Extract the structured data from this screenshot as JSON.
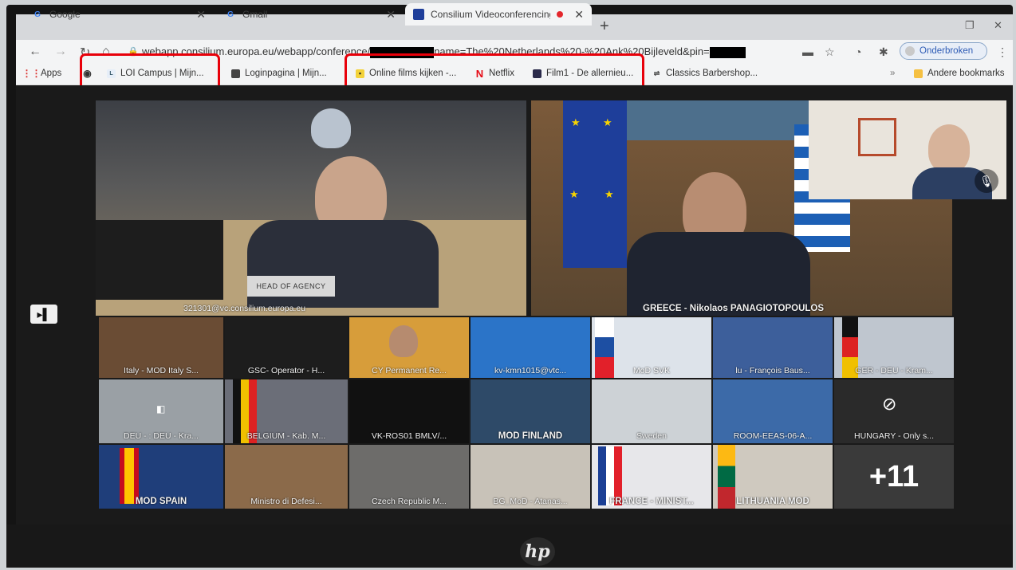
{
  "browser": {
    "tabs": [
      {
        "label": "Google",
        "favicon": "google-icon"
      },
      {
        "label": "Gmail",
        "favicon": "google-icon"
      },
      {
        "label": "Consilium Videoconferencing",
        "favicon": "consilium-icon",
        "active": true
      }
    ],
    "url_visible_start": "webapp.consilium.europa.eu/webapp/conference/",
    "url_visible_middle": "name=The%20Netherlands%20-%20Ank%20Bijleveld&pin=",
    "profile_label": "Onderbroken",
    "bookmarks": [
      {
        "label": "Apps",
        "icon": "apps-grid-icon"
      },
      {
        "label": "LOI Campus | Mijn...",
        "icon": "loi-icon"
      },
      {
        "label": "Loginpagina | Mijn...",
        "icon": "page-icon"
      },
      {
        "label": "Online films kijken -...",
        "icon": "film-icon"
      },
      {
        "label": "Netflix",
        "icon": "netflix-icon"
      },
      {
        "label": "Film1 - De allernieu...",
        "icon": "film1-icon"
      },
      {
        "label": "Classics Barbershop...",
        "icon": "car-icon"
      }
    ],
    "other_bookmarks": "Andere bookmarks",
    "highlight_color": "#e8000a"
  },
  "conference": {
    "main_tiles": [
      {
        "label": "321301@vc.consilium.europa.eu",
        "nameplate": "HEAD OF AGENCY"
      },
      {
        "label": "GREECE - Nikolaos PANAGIOTOPOULOS"
      }
    ],
    "grid": [
      {
        "label": "Italy - MOD Italy S..."
      },
      {
        "label": "GSC- Operator - H..."
      },
      {
        "label": "CY Permanent Re..."
      },
      {
        "label": "kv-kmn1015@vtc..."
      },
      {
        "label": "MoD SVK"
      },
      {
        "label": "lu - François Baus..."
      },
      {
        "label": "GER - DEU - Kram..."
      },
      {
        "label": "DEU - : DEU - Kra..."
      },
      {
        "label": "BELGIUM - Kab. M..."
      },
      {
        "label": "VK-ROS01 BMLV/..."
      },
      {
        "label": "MOD FINLAND"
      },
      {
        "label": "Sweden"
      },
      {
        "label": "ROOM-EEAS-06-A..."
      },
      {
        "label": "HUNGARY - Only s..."
      },
      {
        "label": "MOD SPAIN"
      },
      {
        "label": "Ministro di Defesi..."
      },
      {
        "label": "Czech Republic M..."
      },
      {
        "label": "BG_MoD - Atanas..."
      },
      {
        "label": "FRANCE - MINIST..."
      },
      {
        "label": "LITHUANIA MOD"
      }
    ],
    "more_count": "+11"
  },
  "laptop_brand": "hp"
}
